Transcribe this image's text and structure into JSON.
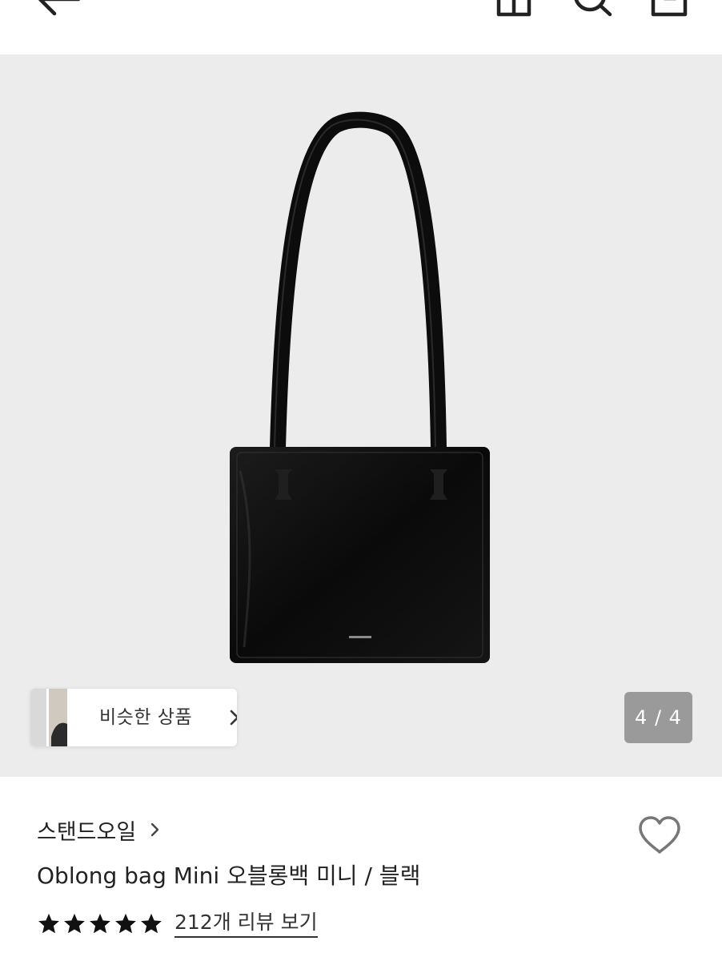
{
  "header": {
    "icons": [
      "back-arrow-icon",
      "home-icon",
      "search-icon",
      "cart-icon"
    ]
  },
  "gallery": {
    "similar_products_label": "비슷한 상품",
    "page_counter": "4 / 4",
    "current_index": 4,
    "total_images": 4,
    "background_color": "#ececec"
  },
  "product": {
    "brand": "스탠드오일",
    "title": "Oblong bag Mini 오블롱백 미니 / 블랙",
    "rating_stars": 5,
    "review_link": "212개 리뷰 보기"
  }
}
